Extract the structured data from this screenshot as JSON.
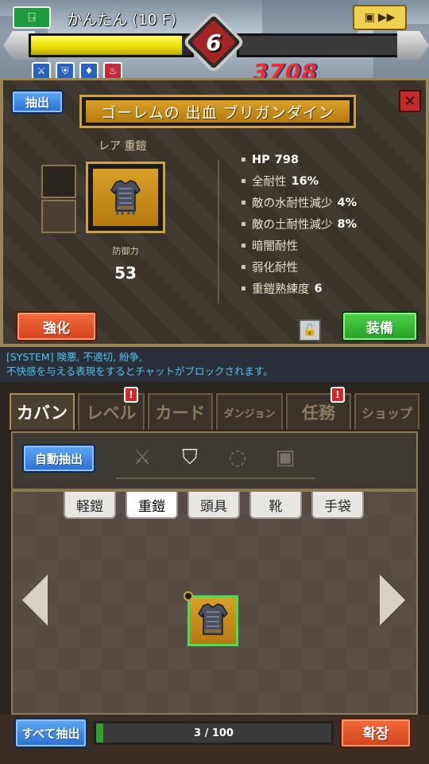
{
  "hud": {
    "exit_icon": "exit-door-icon",
    "title": "かんたん (10 F)",
    "level": "6",
    "score": "3708",
    "exp_fraction": 0.94,
    "buffs": [
      "sword-icon",
      "shield-icon",
      "water-icon",
      "fire-icon"
    ]
  },
  "item": {
    "extract_label": "抽出",
    "name": "ゴーレムの 出血 ブリガンダイン",
    "rarity": "レア 重鎧",
    "defense_label": "防御力",
    "defense_value": "53",
    "stats": [
      {
        "label": "HP",
        "value": "798"
      },
      {
        "label": "全耐性",
        "value": "16%"
      },
      {
        "label": "敵の水耐性減少",
        "value": "4%"
      },
      {
        "label": "敵の土耐性減少",
        "value": "8%"
      },
      {
        "label": "暗闇耐性",
        "value": ""
      },
      {
        "label": "弱化耐性",
        "value": ""
      },
      {
        "label": "重鎧熟練度",
        "value": "6"
      }
    ],
    "enhance_label": "強化",
    "equip_label": "装備"
  },
  "chat": {
    "line1": "[SYSTEM] 険悪, 不適切, 紛争,",
    "line2": "不快感を与える表現をするとチャットがブロックされます。"
  },
  "tabs": [
    {
      "label": "カバン",
      "active": true,
      "badge": false
    },
    {
      "label": "レベル",
      "active": false,
      "badge": true
    },
    {
      "label": "カード",
      "active": false,
      "badge": false
    },
    {
      "label": "ダンジョン",
      "active": false,
      "badge": false
    },
    {
      "label": "任務",
      "active": false,
      "badge": true
    },
    {
      "label": "ショップ",
      "active": false,
      "badge": false
    }
  ],
  "inventory": {
    "auto_extract_label": "自動抽出",
    "filter_icons": [
      "sword-icon",
      "shield-icon",
      "ring-icon",
      "accessory-icon"
    ],
    "subtabs": [
      "軽鎧",
      "重鎧",
      "頭具",
      "靴",
      "手袋"
    ],
    "active_subtab": "重鎧",
    "extract_all_label": "すべて抽出",
    "capacity": "3 / 100",
    "capacity_fraction": 0.03,
    "expand_label": "확장"
  }
}
